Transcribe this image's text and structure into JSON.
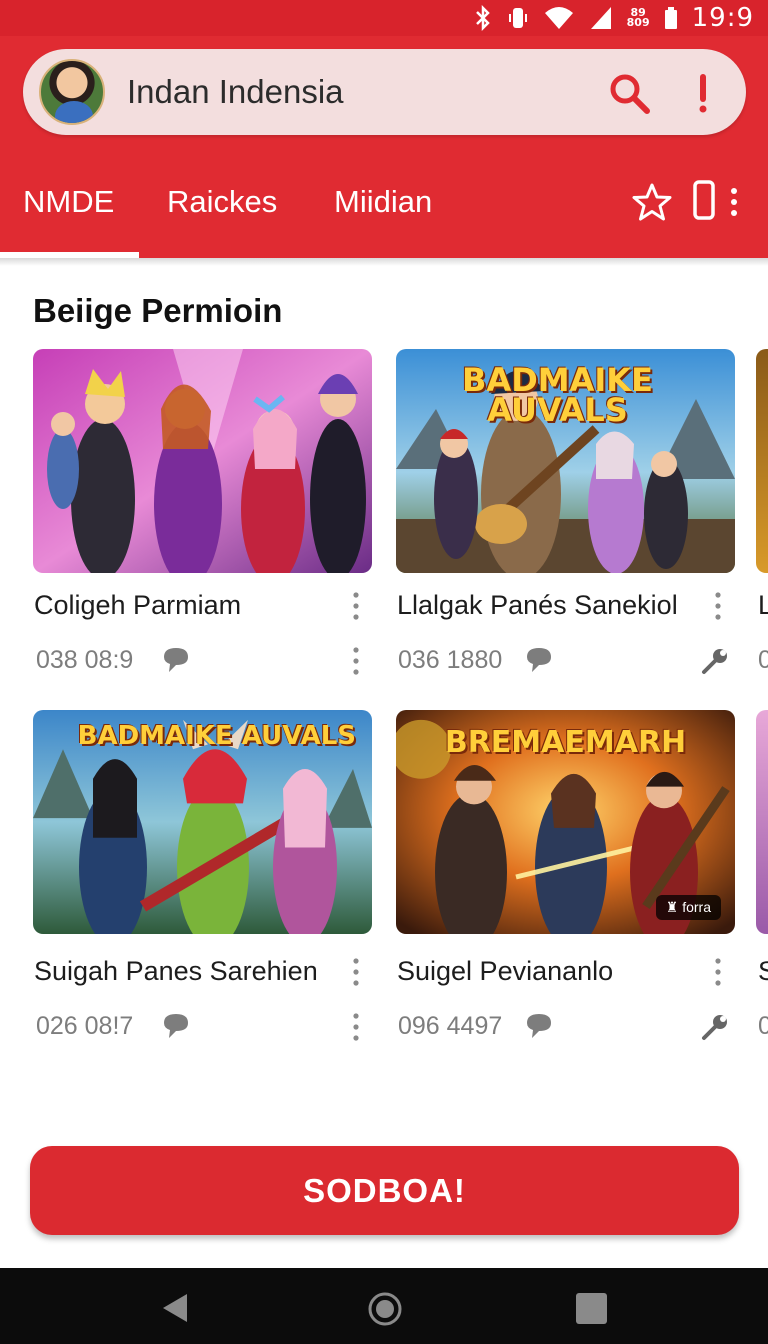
{
  "status_bar": {
    "time": "19:9",
    "network_top": "89",
    "network_bottom": "809"
  },
  "header": {
    "search_title": "Indan Indensia",
    "tabs": [
      {
        "label": "NMDE",
        "active": true
      },
      {
        "label": "Raickes",
        "active": false
      },
      {
        "label": "Miidian",
        "active": false
      }
    ]
  },
  "section": {
    "title": "Beiige Permioin"
  },
  "cards": [
    {
      "title": "Coligeh Parmiam",
      "meta": "038  08:9",
      "meta_icon": "chat-bubble-icon",
      "thumb_logo": ""
    },
    {
      "title": "Llalgak Panés Sanekiol",
      "meta": "036  1880",
      "meta_icon": "chat-bubble-icon",
      "thumb_logo": "BADMAIKE AUVALS"
    },
    {
      "title": "Suigah Panes Sarehien",
      "meta": "026  08!7",
      "meta_icon": "chat-bubble-icon",
      "thumb_logo": "BADMAIKE AUVALS"
    },
    {
      "title": "Suigel Peviananlo",
      "meta": "096  4497",
      "meta_icon": "chat-bubble-icon",
      "thumb_logo": "BREMAEMARH",
      "badge": "forra"
    }
  ],
  "peek": {
    "row1_title": "L",
    "row1_meta": "0",
    "row2_title": "S",
    "row2_meta": "0"
  },
  "cta": {
    "label": "SODBOA!"
  },
  "colors": {
    "brand_red": "#e02b32",
    "status_red": "#d8232c",
    "cta_red": "#db2a30",
    "pill_bg": "#f3dede"
  }
}
